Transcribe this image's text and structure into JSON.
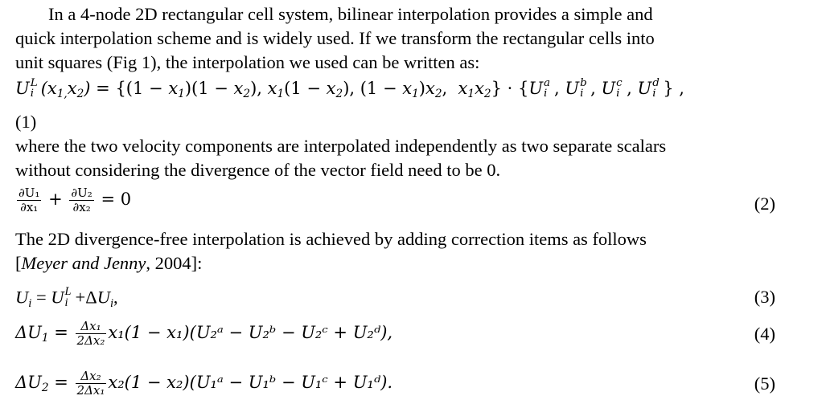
{
  "paragraph1": {
    "line1": "In a 4-node 2D rectangular cell system, bilinear interpolation provides a simple and",
    "line2": "quick interpolation scheme and is widely used. If we transform the rectangular cells into",
    "line3": "unit squares (Fig 1), the interpolation we used can be written as:"
  },
  "equation1": {
    "lhs": "U",
    "lhs_sup": "L",
    "lhs_sub": "i",
    "args": "(x",
    "expr": "= {(1 − x₁)(1 − x₂), x₁(1 − x₂), (1 − x₁)x₂,  x₁x₂} · {U",
    "tail": "} ,",
    "number": "(1)"
  },
  "paragraph2": {
    "line1": "where the two velocity components are interpolated independently as two separate scalars",
    "line2": "without considering the divergence of the vector field need to be 0."
  },
  "equation2": {
    "num1": "∂U₁",
    "den1": "∂x₁",
    "num2": "∂U₂",
    "den2": "∂x₂",
    "rhs": "= 0",
    "number": "(2)"
  },
  "paragraph3": {
    "line1": "The 2D divergence-free interpolation is achieved by adding correction items as follows",
    "line2_open": "[",
    "line2_cite": "Meyer and Jenny",
    "line2_rest": ", 2004]:"
  },
  "equation3": {
    "number": "(3)"
  },
  "equation4": {
    "num": "Δx₁",
    "den": "2Δx₂",
    "body": "x₁(1 − x₁)(U₂ᵃ − U₂ᵇ − U₂ᶜ + U₂ᵈ),",
    "number": "(4)"
  },
  "equation5": {
    "num": "Δx₂",
    "den": "2Δx₁",
    "body": "x₂(1 − x₂)(U₁ᵃ − U₁ᵇ − U₁ᶜ + U₁ᵈ).",
    "number": "(5)"
  }
}
